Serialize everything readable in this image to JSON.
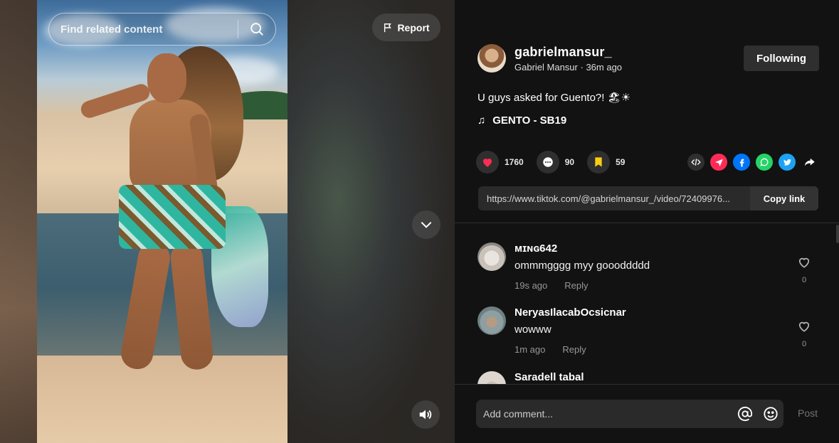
{
  "video": {
    "search_placeholder": "Find related content",
    "report_label": "Report"
  },
  "author": {
    "username": "gabrielmansur_",
    "display_name": "Gabriel Mansur",
    "separator": " · ",
    "posted_ago": "36m ago",
    "follow_label": "Following"
  },
  "post": {
    "caption": "U guys asked for Guento?! 🏖☀",
    "music": "GENTO - SB19"
  },
  "stats": {
    "likes": "1760",
    "comments": "90",
    "saves": "59"
  },
  "share": {
    "icons": [
      "embed-icon",
      "send-to-friends-icon",
      "facebook-icon",
      "whatsapp-icon",
      "twitter-icon",
      "share-arrow-icon"
    ],
    "colors": {
      "send": "#fe2c55",
      "facebook": "#0075fa",
      "whatsapp": "#25d366",
      "twitter": "#1da1f2",
      "like": "#fe2c55",
      "save": "#facc15"
    }
  },
  "link": {
    "url": "https://www.tiktok.com/@gabrielmansur_/video/72409976...",
    "copy_label": "Copy link"
  },
  "comments": [
    {
      "user": "ᴍɪɴɢ642",
      "text": "ommmgggg myy goooddddd",
      "time": "19s ago",
      "reply": "Reply",
      "likes": "0"
    },
    {
      "user": "NeryasIlacabOcsicnar",
      "text": "wowww",
      "time": "1m ago",
      "reply": "Reply",
      "likes": "0"
    },
    {
      "user": "Saradell tabal",
      "text": "",
      "time": "",
      "reply": "",
      "likes": ""
    }
  ],
  "composer": {
    "placeholder": "Add comment...",
    "post_label": "Post"
  }
}
